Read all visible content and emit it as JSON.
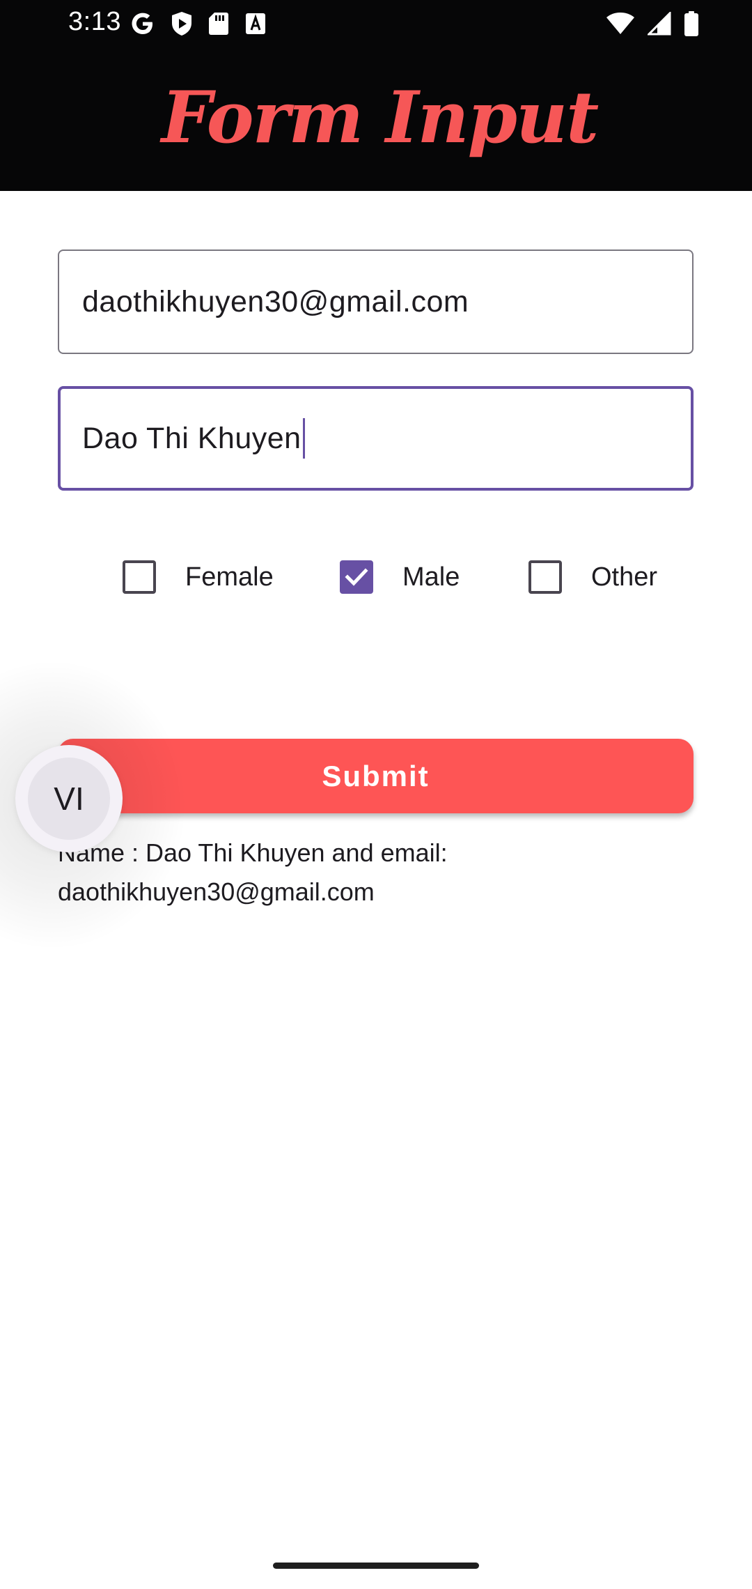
{
  "status_bar": {
    "time": "3:13",
    "left_icons": [
      "google-icon",
      "shield-play-icon",
      "sd-card-icon",
      "font-a-icon"
    ],
    "right_icons": [
      "wifi-icon",
      "cell-signal-icon",
      "battery-icon"
    ]
  },
  "app_bar": {
    "title": "Form Input",
    "title_color": "#f65757",
    "background": "#060607"
  },
  "form": {
    "email_value": "daothikhuyen30@gmail.com",
    "name_value": "Dao Thi Khuyen",
    "gender_options": [
      {
        "label": "Female",
        "checked": false
      },
      {
        "label": "Male",
        "checked": true
      },
      {
        "label": "Other",
        "checked": false
      }
    ],
    "submit_label": "Submit",
    "submit_color": "#fe5555",
    "focus_color": "#6750a4"
  },
  "result": {
    "line1": "Name : Dao Thi Khuyen and email:",
    "line2": "daothikhuyen30@gmail.com"
  },
  "floating_bubble": {
    "label": "VI"
  }
}
